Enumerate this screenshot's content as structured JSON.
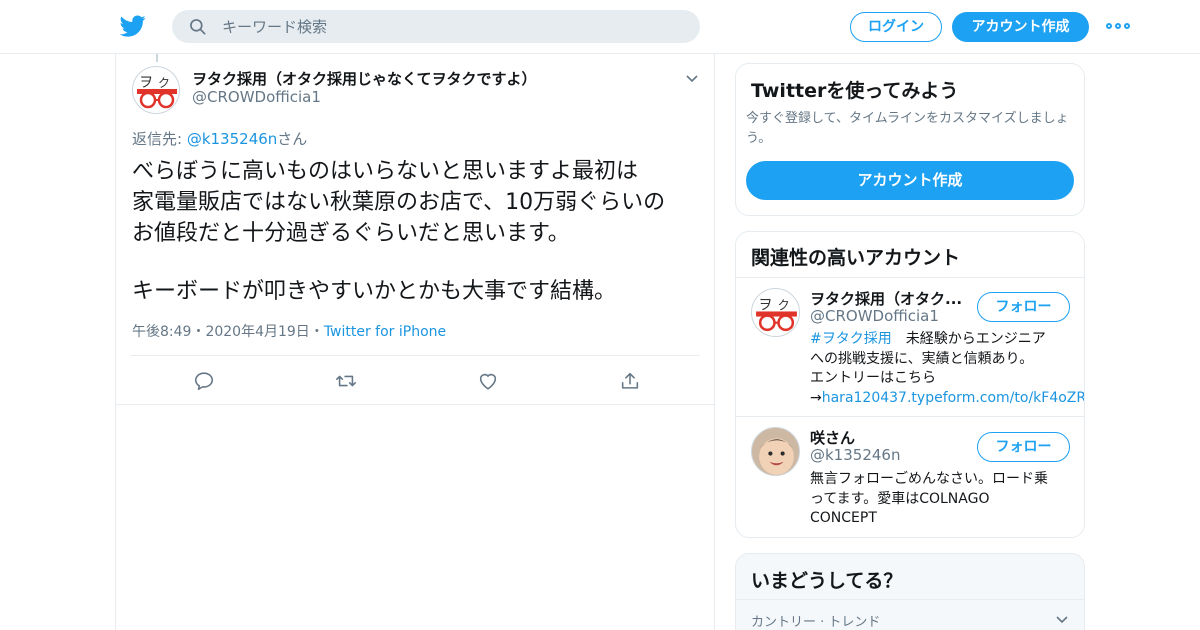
{
  "header": {
    "search_placeholder": "キーワード検索",
    "login_label": "ログイン",
    "signup_label": "アカウント作成",
    "brand_color": "#1da1f2"
  },
  "tweet": {
    "name": "ヲタク採用（オタク採用じゃなくてヲタクですよ）",
    "handle": "@CROWDofficia1",
    "reply_prefix": "返信先: ",
    "reply_mention": "@k135246n",
    "reply_suffix": "さん",
    "text_lines": [
      "べらぼうに高いものはいらないと思いますよ最初は",
      "家電量販店ではない秋葉原のお店で、10万弱ぐらいの",
      "お値段だと十分過ぎるぐらいだと思います。",
      "キーボードが叩きやすいかとかも大事です結構。"
    ],
    "time": "午後8:49",
    "date": "2020年4月19日",
    "source": "Twitter for iPhone",
    "meta_sep": "・"
  },
  "signup_card": {
    "title": "Twitterを使ってみよう",
    "description": "今すぐ登録して、タイムラインをカスタマイズしましょう。",
    "button_label": "アカウント作成"
  },
  "related": {
    "title": "関連性の高いアカウント",
    "follow_label": "フォロー",
    "accounts": [
      {
        "name": "ヲタク採用（オタク...",
        "handle": "@CROWDofficia1",
        "bio_tag": "#ヲタク採用",
        "bio_line1": "　未経験からエンジニア",
        "bio_line2": "への挑戦支援に、実績と信頼あり。",
        "bio_line3": "エントリーはこちら",
        "bio_arrow": "→",
        "bio_link": "hara120437.typeform.com/to/kF4oZR"
      },
      {
        "name": "咲さん",
        "handle": "@k135246n",
        "bio_line1": "無言フォローごめんなさい。ロード乗",
        "bio_line2": "ってます。愛車はCOLNAGO",
        "bio_line3": "CONCEPT"
      }
    ]
  },
  "trends": {
    "title": "いまどうしてる？",
    "subtitle": "カントリー · トレンド"
  }
}
